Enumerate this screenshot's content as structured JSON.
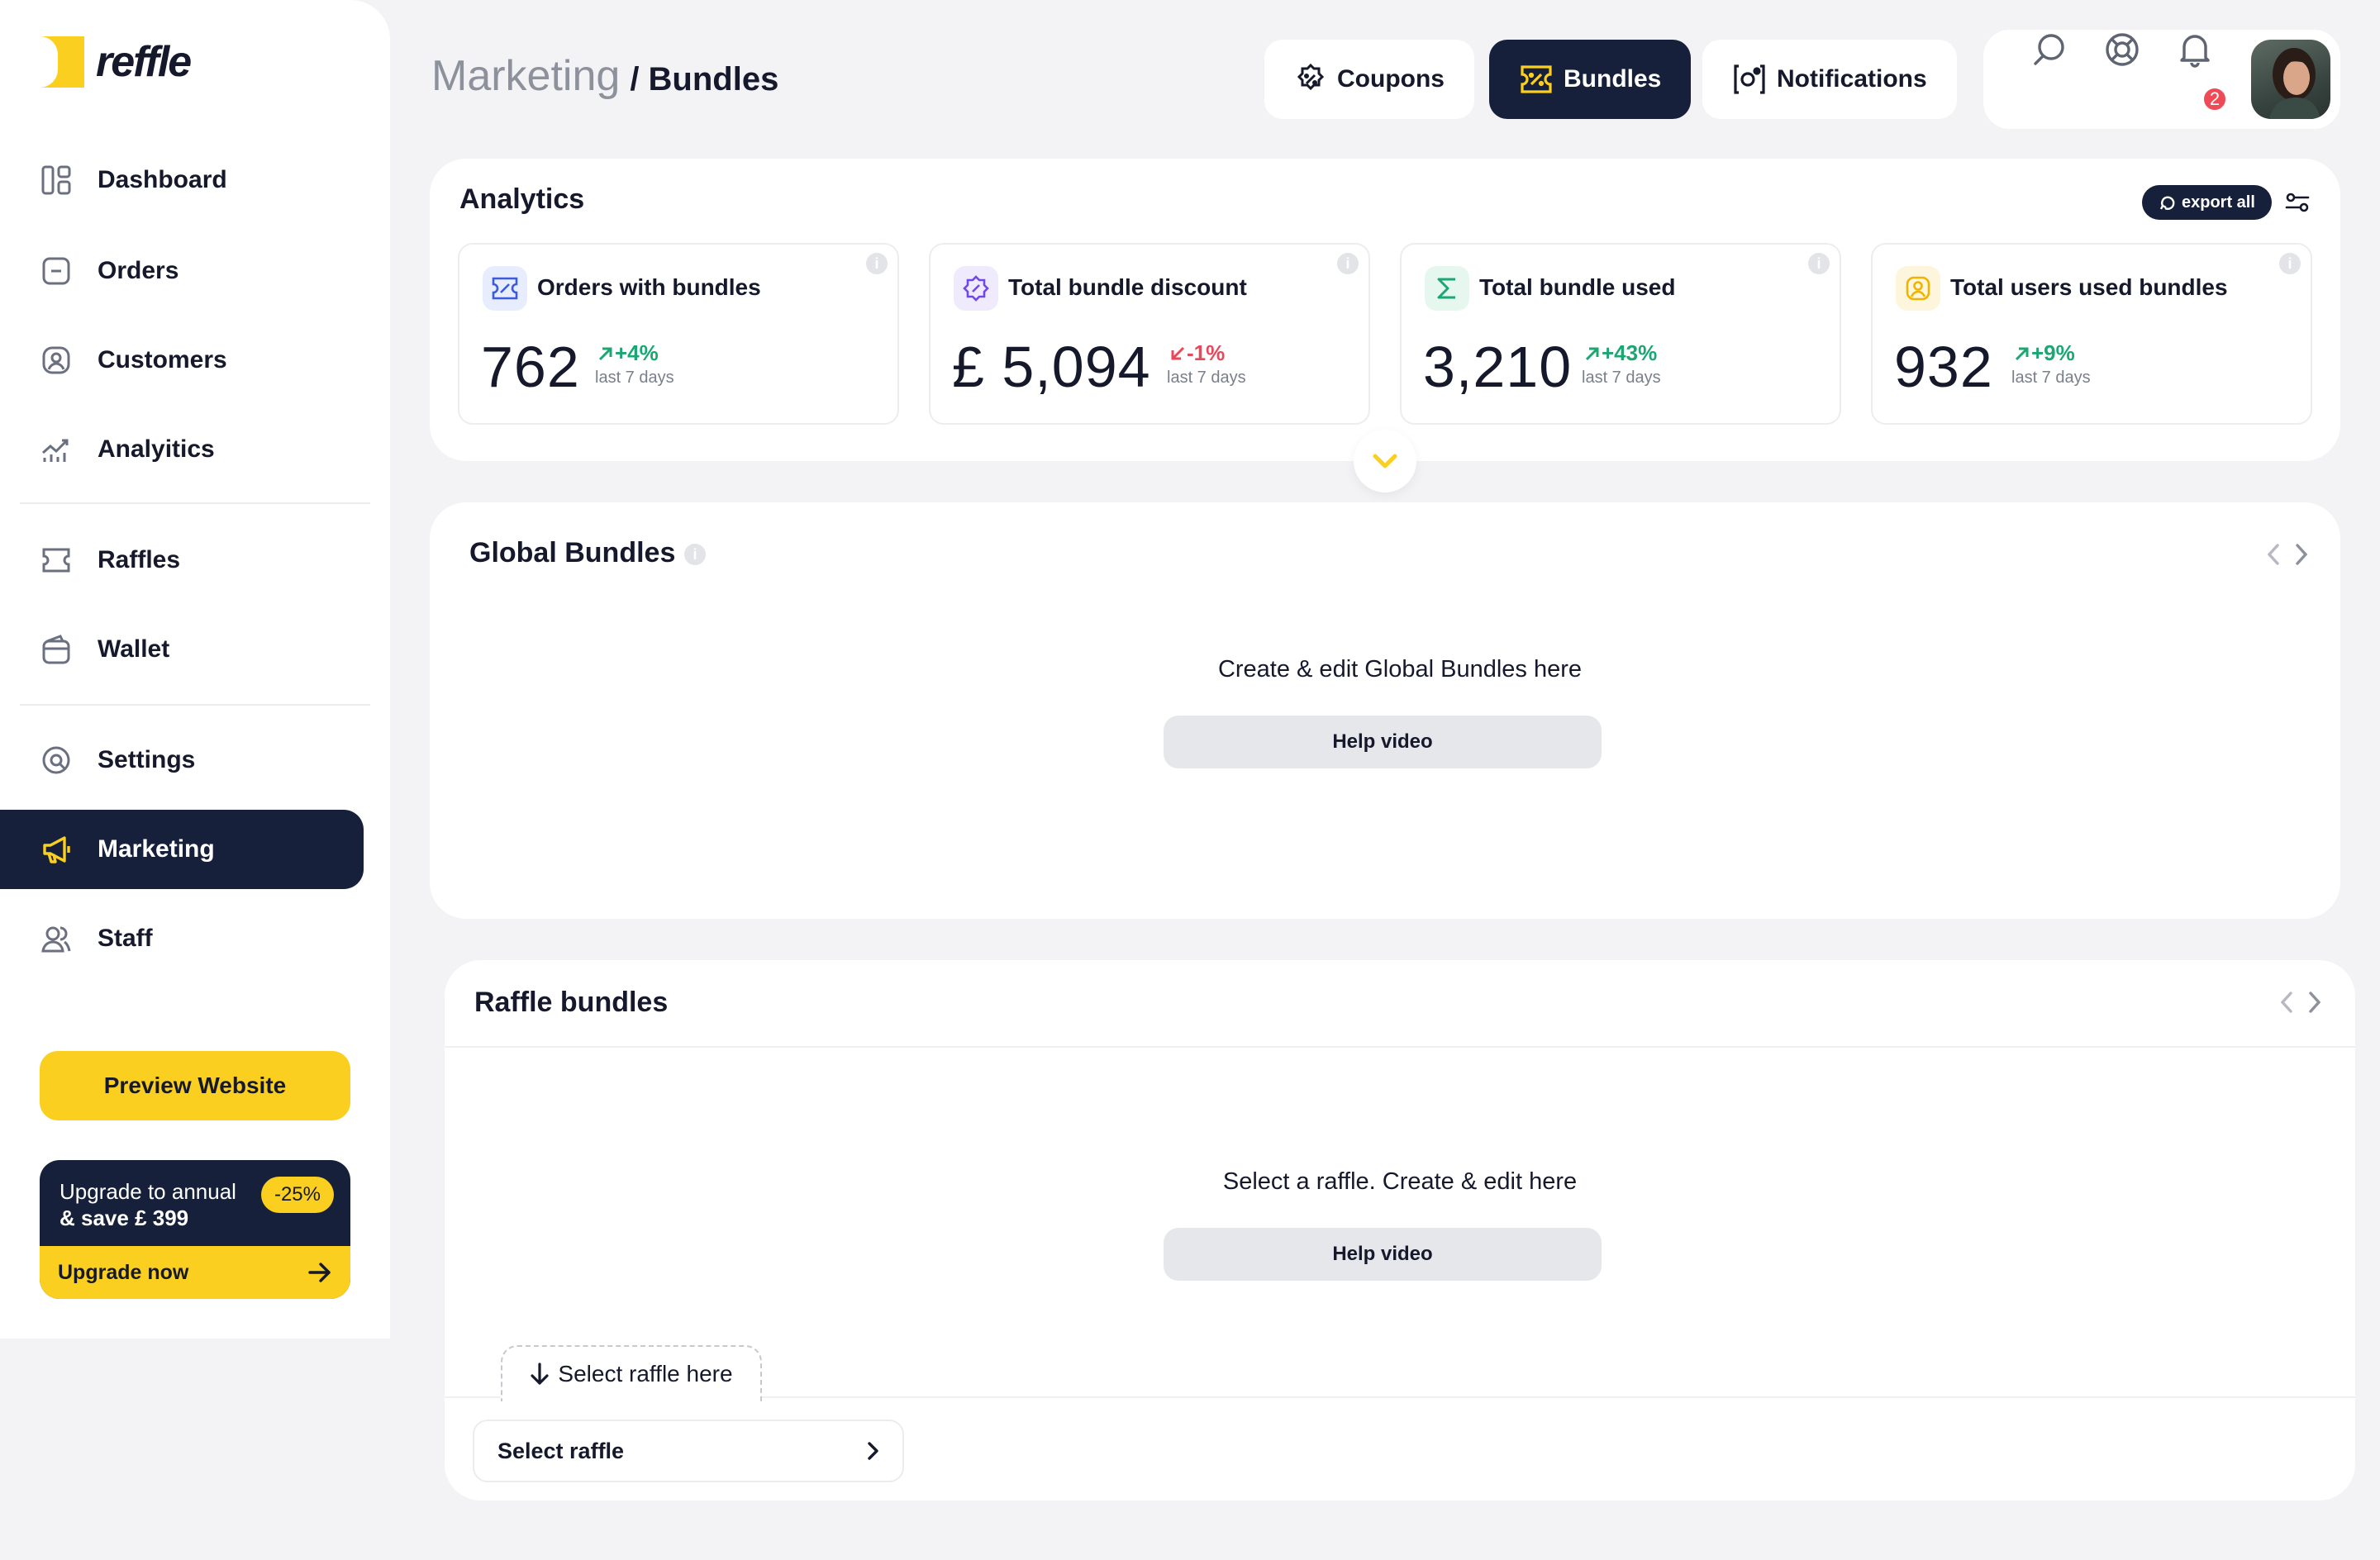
{
  "app": {
    "logo_text": "reffle",
    "brand_color": "#fbcf1f",
    "dark_color": "#16203a"
  },
  "sidebar": {
    "items": [
      {
        "label": "Dashboard",
        "icon": "dashboard-icon"
      },
      {
        "label": "Orders",
        "icon": "orders-icon"
      },
      {
        "label": "Customers",
        "icon": "customers-icon"
      },
      {
        "label": "Analyitics",
        "icon": "analytics-icon"
      },
      {
        "label": "Raffles",
        "icon": "ticket-icon"
      },
      {
        "label": "Wallet",
        "icon": "wallet-icon"
      },
      {
        "label": "Settings",
        "icon": "settings-icon"
      },
      {
        "label": "Marketing",
        "icon": "megaphone-icon",
        "active": true
      },
      {
        "label": "Staff",
        "icon": "staff-icon"
      }
    ],
    "preview_label": "Preview Website",
    "upgrade": {
      "line1": "Upgrade to annual",
      "line2": "& save £ 399",
      "badge": "-25%",
      "cta": "Upgrade now"
    }
  },
  "header": {
    "breadcrumb_section": "Marketing",
    "breadcrumb_page": "/ Bundles",
    "tabs": [
      {
        "label": "Coupons",
        "icon": "coupon-icon"
      },
      {
        "label": "Bundles",
        "icon": "bundle-icon",
        "active": true
      },
      {
        "label": "Notifications",
        "icon": "notification-tab-icon"
      }
    ],
    "notification_count": "2"
  },
  "analytics": {
    "title": "Analytics",
    "export_label": "export all",
    "stats": [
      {
        "title": "Orders with bundles",
        "value": "762",
        "change": "+4%",
        "direction": "up",
        "period": "last 7 days",
        "icon": "ticket-percent-icon",
        "icon_color": "#3b5bdb"
      },
      {
        "title": "Total bundle discount",
        "value": "£ 5,094",
        "change": "-1%",
        "direction": "down",
        "period": "last 7 days",
        "icon": "discount-badge-icon",
        "icon_color": "#7048e8"
      },
      {
        "title": "Total bundle used",
        "value": "3,210",
        "change": "+43%",
        "direction": "up",
        "period": "last 7 days",
        "icon": "sigma-icon",
        "icon_color": "#1aa772"
      },
      {
        "title": "Total users used bundles",
        "value": "932",
        "change": "+9%",
        "direction": "up",
        "period": "last 7 days",
        "icon": "user-icon",
        "icon_color": "#f0b400"
      }
    ]
  },
  "global_bundles": {
    "title": "Global Bundles",
    "message": "Create & edit Global Bundles here",
    "help_label": "Help video"
  },
  "raffle_bundles": {
    "title": "Raffle bundles",
    "message": "Select a raffle. Create & edit here",
    "help_label": "Help video",
    "hint": "Select raffle here",
    "select_label": "Select raffle"
  }
}
